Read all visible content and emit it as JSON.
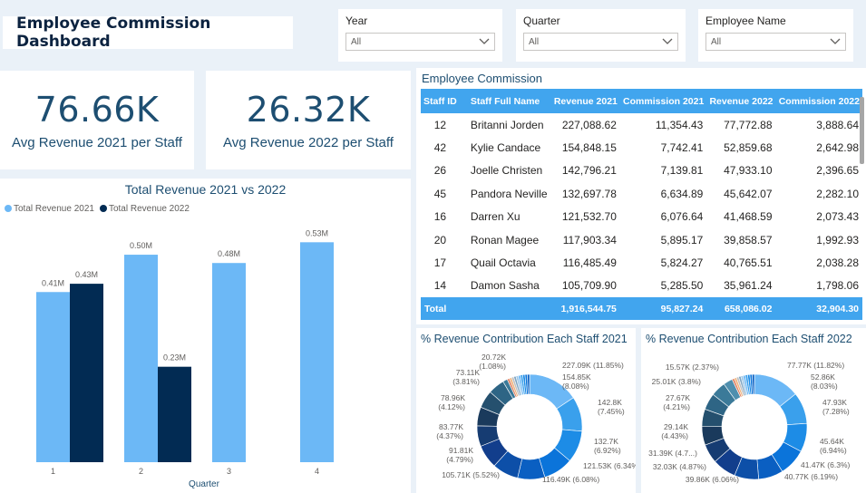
{
  "title": "Employee Commission Dashboard",
  "slicers": [
    {
      "label": "Year",
      "value": "All"
    },
    {
      "label": "Quarter",
      "value": "All"
    },
    {
      "label": "Employee Name",
      "value": "All"
    }
  ],
  "kpis": [
    {
      "value": "76.66K",
      "caption": "Avg Revenue 2021 per Staff"
    },
    {
      "value": "26.32K",
      "caption": "Avg Revenue 2022 per Staff"
    }
  ],
  "bar_legend": [
    "Total Revenue 2021",
    "Total Revenue 2022"
  ],
  "colors": {
    "series2021": "#6cb8f6",
    "series2022": "#022b53",
    "header": "#41a5ee",
    "accent": "#1d4e71"
  },
  "chart_data": [
    {
      "type": "bar",
      "title": "Total Revenue 2021 vs 2022",
      "xlabel": "Quarter",
      "ylabel": "",
      "categories": [
        "1",
        "2",
        "3",
        "4"
      ],
      "series": [
        {
          "name": "Total Revenue 2021",
          "values": [
            0.41,
            0.5,
            0.48,
            0.53
          ],
          "labels": [
            "0.41M",
            "0.50M",
            "0.48M",
            "0.53M"
          ]
        },
        {
          "name": "Total Revenue 2022",
          "values": [
            0.43,
            0.23,
            null,
            null
          ],
          "labels": [
            "0.43M",
            "0.23M",
            "",
            ""
          ]
        }
      ],
      "legend": "top-left",
      "grid": false
    },
    {
      "type": "pie",
      "title": "% Revenue Contribution Each Staff 2021",
      "donut": true,
      "labels": [
        "227.09K (11.85%)",
        "154.85K (8.08%)",
        "142.8K (7.45%)",
        "132.7K (6.92%)",
        "121.53K (6.34%)",
        "116.49K (6.08%)",
        "105.71K (5.52%)",
        "91.81K (4.79%)",
        "83.77K (4.37%)",
        "78.96K (4.12%)",
        "73.11K (3.81%)",
        "20.72K (1.08%)"
      ],
      "values": [
        227.09,
        154.85,
        142.8,
        132.7,
        121.53,
        116.49,
        105.71,
        91.81,
        83.77,
        78.96,
        73.11,
        20.72
      ]
    },
    {
      "type": "pie",
      "title": "% Revenue Contribution Each Staff 2022",
      "donut": true,
      "labels": [
        "77.77K (11.82%)",
        "52.86K (8.03%)",
        "47.93K (7.28%)",
        "45.64K (6.94%)",
        "41.47K (6.3%)",
        "40.77K (6.19%)",
        "39.86K (6.06%)",
        "32.03K (4.87%)",
        "31.39K (4.7...)",
        "29.14K (4.43%)",
        "27.67K (4.21%)",
        "25.01K (3.8%)",
        "15.57K (2.37%)"
      ],
      "values": [
        77.77,
        52.86,
        47.93,
        45.64,
        41.47,
        40.77,
        39.86,
        32.03,
        31.39,
        29.14,
        27.67,
        25.01,
        15.57
      ]
    }
  ],
  "table": {
    "title": "Employee Commission",
    "headers": [
      "Staff ID",
      "Staff Full Name",
      "Revenue 2021",
      "Commission 2021",
      "Revenue 2022",
      "Commission 2022"
    ],
    "rows": [
      [
        "12",
        "Britanni Jorden",
        "227,088.62",
        "11,354.43",
        "77,772.88",
        "3,888.64"
      ],
      [
        "42",
        "Kylie Candace",
        "154,848.15",
        "7,742.41",
        "52,859.68",
        "2,642.98"
      ],
      [
        "26",
        "Joelle Christen",
        "142,796.21",
        "7,139.81",
        "47,933.10",
        "2,396.65"
      ],
      [
        "45",
        "Pandora Neville",
        "132,697.78",
        "6,634.89",
        "45,642.07",
        "2,282.10"
      ],
      [
        "16",
        "Darren Xu",
        "121,532.70",
        "6,076.64",
        "41,468.59",
        "2,073.43"
      ],
      [
        "20",
        "Ronan Magee",
        "117,903.34",
        "5,895.17",
        "39,858.57",
        "1,992.93"
      ],
      [
        "17",
        "Quail Octavia",
        "116,485.49",
        "5,824.27",
        "40,765.51",
        "2,038.28"
      ],
      [
        "14",
        "Damon Sasha",
        "105,709.90",
        "5,285.50",
        "35,961.24",
        "1,798.06"
      ]
    ],
    "total": [
      "Total",
      "",
      "1,916,544.75",
      "95,827.24",
      "658,086.02",
      "32,904.30"
    ]
  }
}
